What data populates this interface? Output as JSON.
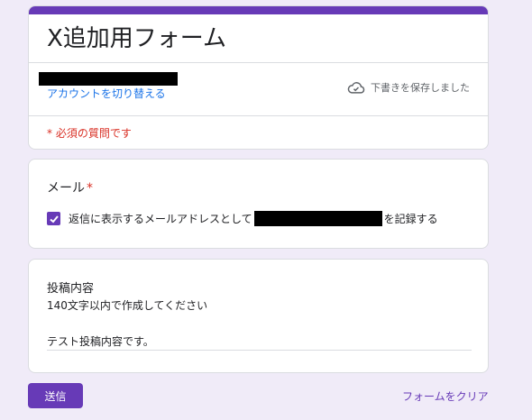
{
  "colors": {
    "accent": "#673ab7",
    "background": "#f0ebf8",
    "link": "#1a73e8",
    "required": "#d93025"
  },
  "header": {
    "title": "X追加用フォーム",
    "account_switch_label": "アカウントを切り替える",
    "draft_status": "下書きを保存しました",
    "draft_icon": "cloud-done-icon",
    "required_note": "* 必須の質問です"
  },
  "email_question": {
    "title": "メール",
    "required_mark": "*",
    "checkbox_checked": true,
    "checkbox_label_before": "返信に表示するメールアドレスとして",
    "checkbox_label_after": "を記録する"
  },
  "post_question": {
    "title": "投稿内容",
    "description": "140文字以内で作成してください",
    "answer_value": "テスト投稿内容です。"
  },
  "footer": {
    "submit_label": "送信",
    "clear_label": "フォームをクリア"
  }
}
